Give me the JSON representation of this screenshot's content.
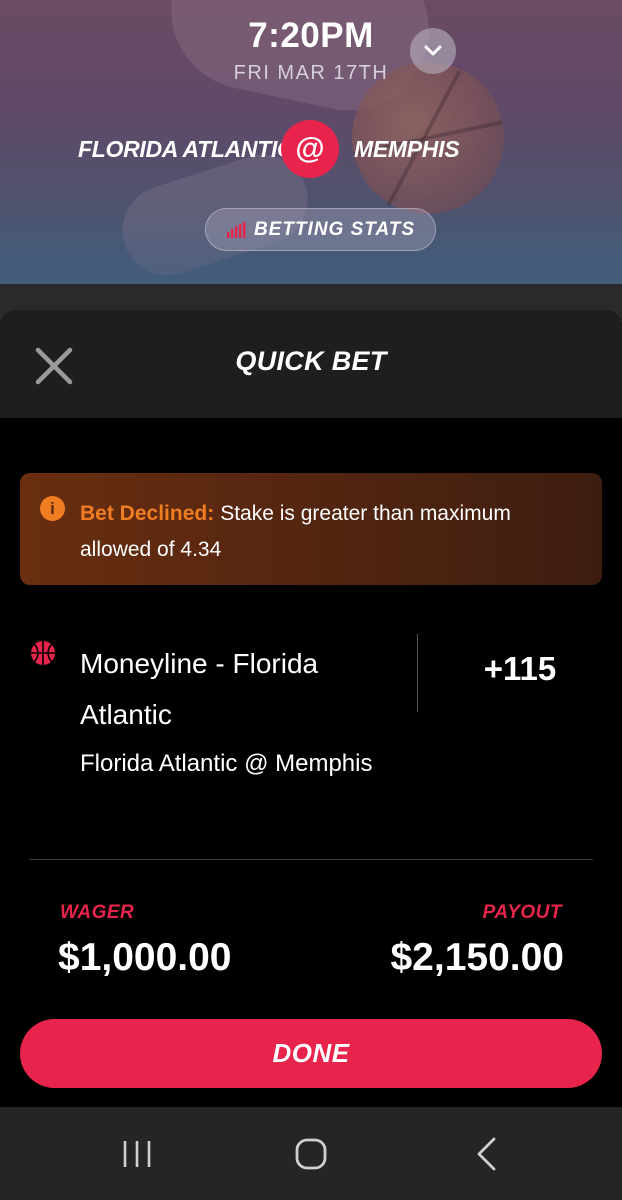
{
  "game": {
    "time": "7:20PM",
    "date": "FRI MAR 17TH",
    "away_team": "FLORIDA ATLANTIC",
    "home_team": "MEMPHIS",
    "at_symbol": "@",
    "betting_stats_label": "BETTING STATS",
    "accent_color": "#e8234c"
  },
  "sheet": {
    "title": "QUICK BET",
    "close_icon": "close-icon"
  },
  "alert": {
    "icon": "info-icon",
    "title": "Bet Declined:",
    "message_line1": "Stake is greater than maximum",
    "message_line2": "allowed of 4.34",
    "color": "#f07d22"
  },
  "bet": {
    "sport_icon": "basketball-icon",
    "market": "Moneyline - Florida Atlantic",
    "event": "Florida Atlantic @ Memphis",
    "odds": "+115"
  },
  "totals": {
    "wager_label": "WAGER",
    "wager_value": "$1,000.00",
    "payout_label": "PAYOUT",
    "payout_value": "$2,150.00"
  },
  "actions": {
    "done_label": "DONE"
  },
  "system_nav": {
    "recent": "recent-apps-icon",
    "home": "home-icon",
    "back": "back-icon"
  }
}
